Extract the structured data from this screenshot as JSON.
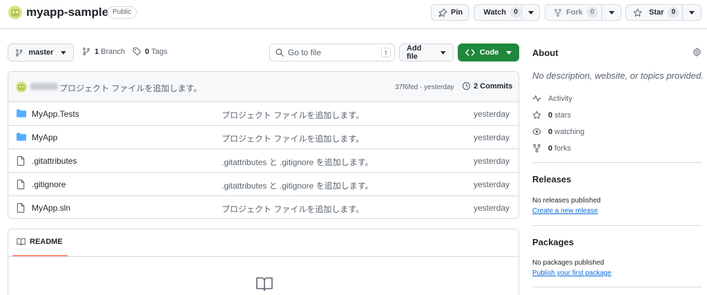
{
  "header": {
    "repo_name": "myapp-sample",
    "visibility": "Public",
    "pin_label": "Pin",
    "watch_label": "Watch",
    "watch_count": "0",
    "fork_label": "Fork",
    "fork_count": "0",
    "star_label": "Star",
    "star_count": "0"
  },
  "toolbar": {
    "branch_name": "master",
    "branch_count": "1",
    "branch_label": "Branch",
    "tag_count": "0",
    "tag_label": "Tags",
    "search_placeholder": "Go to file",
    "search_shortcut": "t",
    "add_file_label": "Add file",
    "code_label": "Code"
  },
  "commit": {
    "message": "プロジェクト ファイルを追加します。",
    "sha_time": "37f6fed · yesterday",
    "commits_label": "2 Commits"
  },
  "files": [
    {
      "type": "dir",
      "name": "MyApp.Tests",
      "message": "プロジェクト ファイルを追加します。",
      "date": "yesterday"
    },
    {
      "type": "dir",
      "name": "MyApp",
      "message": "プロジェクト ファイルを追加します。",
      "date": "yesterday"
    },
    {
      "type": "file",
      "name": ".gitattributes",
      "message": ".gitattributes と .gitignore を追加します。",
      "date": "yesterday"
    },
    {
      "type": "file",
      "name": ".gitignore",
      "message": ".gitattributes と .gitignore を追加します。",
      "date": "yesterday"
    },
    {
      "type": "file",
      "name": "MyApp.sln",
      "message": "プロジェクト ファイルを追加します。",
      "date": "yesterday"
    }
  ],
  "readme": {
    "tab_label": "README"
  },
  "sidebar": {
    "about_title": "About",
    "description": "No description, website, or topics provided.",
    "activity_label": "Activity",
    "stars_count": "0",
    "stars_label": "stars",
    "watching_count": "0",
    "watching_label": "watching",
    "forks_count": "0",
    "forks_label": "forks",
    "releases_title": "Releases",
    "releases_note": "No releases published",
    "releases_link": "Create a new release",
    "packages_title": "Packages",
    "packages_note": "No packages published",
    "packages_link": "Publish your first package"
  },
  "colors": {
    "accent_green": "#1f883d",
    "link_blue": "#0969da",
    "folder_blue": "#54aeff",
    "border": "#d1d9e0",
    "tab_underline": "#fd8c73"
  }
}
